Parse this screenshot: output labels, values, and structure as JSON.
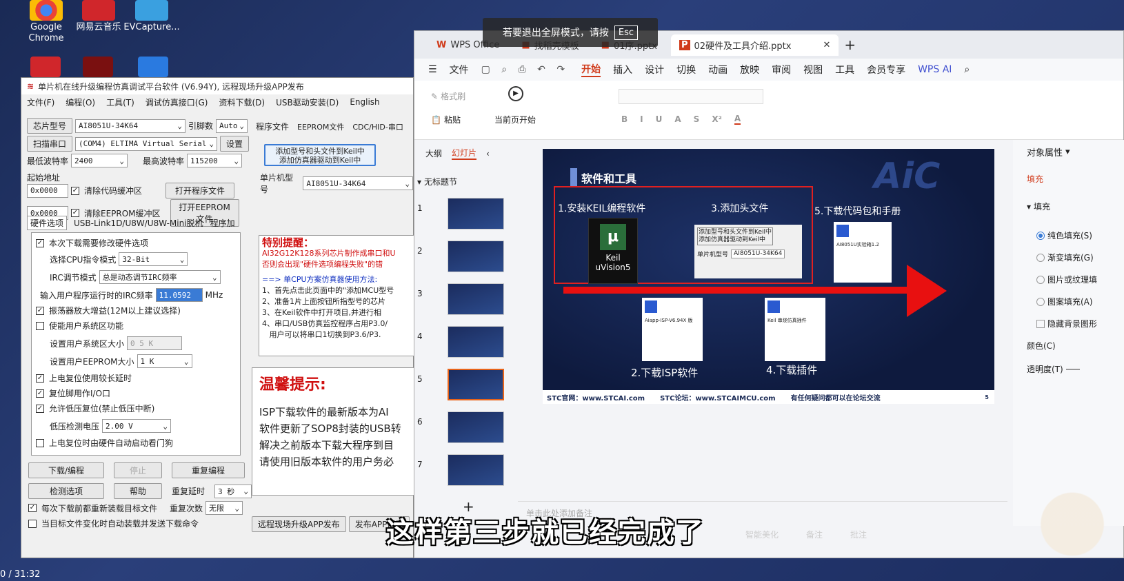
{
  "desktop": {
    "icons": [
      {
        "label": "Google\nChrome",
        "color": "#2f7ed8"
      },
      {
        "label": "网易云音乐",
        "color": "#d0262b"
      },
      {
        "label": "EVCapture...",
        "color": "#3aa0e0"
      }
    ]
  },
  "esc_banner": {
    "text": "若要退出全屏模式，请按",
    "key": "Esc"
  },
  "stc": {
    "title": "单片机在线升级编程仿真调试平台软件 (V6.94Y), 远程现场升级APP发布",
    "menu": [
      "文件(F)",
      "编程(O)",
      "工具(T)",
      "调试仿真接口(G)",
      "资料下载(D)",
      "USB驱动安装(D)",
      "English"
    ],
    "chip_label": "芯片型号",
    "chip_value": "AI8051U-34K64",
    "pin_label": "引脚数",
    "pin_value": "Auto",
    "scan_button": "扫描串口",
    "port_value": "(COM4) ELTIMA Virtual Serial",
    "settings_button": "设置",
    "min_baud_label": "最低波特率",
    "min_baud_value": "2400",
    "max_baud_label": "最高波特率",
    "max_baud_value": "115200",
    "start_addr_label": "起始地址",
    "addr1": "0x0000",
    "clear_code_label": "清除代码缓冲区",
    "open_program_button": "打开程序文件",
    "addr2": "0x0000",
    "clear_eeprom_label": "清除EEPROM缓冲区",
    "open_eeprom_button": "打开EEPROM文件",
    "hw_tabs": [
      "硬件选项",
      "USB-Link1D/U8W/U8W-Mini脱机",
      "程序加"
    ],
    "options": {
      "modify_hw": "本次下载需要修改硬件选项",
      "cpu_mode_label": "选择CPU指令模式",
      "cpu_mode_value": "32-Bit",
      "irc_mode_label": "IRC调节模式",
      "irc_mode_value": "总是动态调节IRC频率",
      "irc_freq_label": "输入用户程序运行时的IRC频率",
      "irc_freq_value": "11.0592",
      "irc_freq_unit": "MHz",
      "osc_gain": "振荡器放大增益(12M以上建议选择)",
      "user_sys": "使能用户系统区功能",
      "user_sys_size_label": "设置用户系统区大小",
      "user_sys_size_value": "0 5 K",
      "user_eeprom_label": "设置用户EEPROM大小",
      "user_eeprom_value": "1   K",
      "long_delay": "上电复位使用较长延时",
      "reset_io": "复位脚用作I/O口",
      "low_volt_reset": "允许低压复位(禁止低压中断)",
      "low_volt_label": "低压检测电压",
      "low_volt_value": "2.00 V",
      "watchdog": "上电复位时由硬件自动启动看门狗"
    },
    "download_button": "下载/编程",
    "stop_button": "停止",
    "reprogram_button": "重复编程",
    "check_button": "检测选项",
    "help_button": "帮助",
    "repeat_delay_label": "重复延时",
    "repeat_delay_value": "3 秒",
    "repeat_count_label": "重复次数",
    "repeat_count_value": "无限",
    "reload_each": "每次下载前都重新装载目标文件",
    "auto_send": "当目标文件变化时自动装载并发送下载命令",
    "right_tabs": [
      "程序文件",
      "EEPROM文件",
      "CDC/HID-串口"
    ],
    "add_keil_button_line1": "添加型号和头文件到Keil中",
    "add_keil_button_line2": "添加仿真器驱动到Keil中",
    "mcu_model_label": "单片机型号",
    "mcu_model_value": "AI8051U-34K64",
    "notice_title": "特别提醒：",
    "notice_line1": "AI32G12K128系列芯片制作成串口和U",
    "notice_line2": "否则会出现\"硬件选项编程失败\"的错",
    "method_title": "==> 单CPU方案仿真器使用方法:",
    "method_lines": [
      "1、首先点击此页面中的\"添加MCU型号",
      "2、准备1片上面按钮所指型号的芯片",
      "3、在Keil软件中打开项目,并进行相",
      "4、串口/USB仿真监控程序占用P3.0/",
      "   用户可以将串口1切换到P3.6/P3."
    ],
    "tip_title": "温馨提示:",
    "tip_lines": [
      "ISP下载软件的最新版本为AI",
      "软件更新了SOP8封装的USB转",
      "解决之前版本下载大程序到目",
      "请使用旧版本软件的用户务必"
    ],
    "bottom_btn1": "远程现场升级APP发布",
    "bottom_btn2": "发布APP帮助"
  },
  "wps": {
    "tabs": [
      "WPS Office",
      "找稻壳模板",
      "01序.pptx",
      "02硬件及工具介绍.pptx"
    ],
    "menu": [
      "文件",
      "开始",
      "插入",
      "设计",
      "切换",
      "动画",
      "放映",
      "审阅",
      "视图",
      "工具",
      "会员专享",
      "WPS AI"
    ],
    "ribbon_labels": [
      "格式刷",
      "粘贴",
      "当前页开始",
      "B",
      "I",
      "U",
      "A",
      "S",
      "X²",
      "A"
    ],
    "outline_tabs": [
      "大纲",
      "幻灯片"
    ],
    "section_title": "无标题节",
    "thumb_numbers": [
      "1",
      "2",
      "3",
      "4",
      "5",
      "6",
      "7"
    ],
    "slide": {
      "title": "软件和工具",
      "logo": "AiC",
      "step1": "1.安装KEIL编程软件",
      "step2": "2.下载ISP软件",
      "step3": "3.添加头文件",
      "step4": "4.下载插件",
      "step5": "5.下载代码包和手册",
      "keil_label_line1": "Keil",
      "keil_label_line2": "uVision5",
      "mini_button_line1": "添加型号和头文件到Keil中",
      "mini_button_line2": "添加仿真器驱动到Keil中",
      "mini_mcu_label": "单片机型号",
      "mini_mcu_value": "AI8051U-34K64",
      "card_isp": "Aiapp-ISP-V6.94X 版",
      "card_plugin": "Keil 串烧仿真插件",
      "card_manual": "AI8051U实验箱1.2",
      "footer_site": "STC官网：www.STCAI.com",
      "footer_forum": "STC论坛：www.STCAIMCU.com",
      "footer_note": "有任何疑问都可以在论坛交流",
      "page_no": "5"
    },
    "notes_placeholder": "单击此处添加备注",
    "props": {
      "header": "对象属性",
      "tab": "填充",
      "section": "填充",
      "options": [
        "纯色填充(S)",
        "渐变填充(G)",
        "图片或纹理填",
        "图案填充(A)"
      ],
      "hide_bg": "隐藏背景图形",
      "color_label": "颜色(C)",
      "transparency_label": "透明度(T)"
    },
    "status": [
      "智能美化",
      "备注",
      "批注"
    ]
  },
  "subtitle": "这样第三步就已经完成了",
  "video_time": "0 / 31:32"
}
